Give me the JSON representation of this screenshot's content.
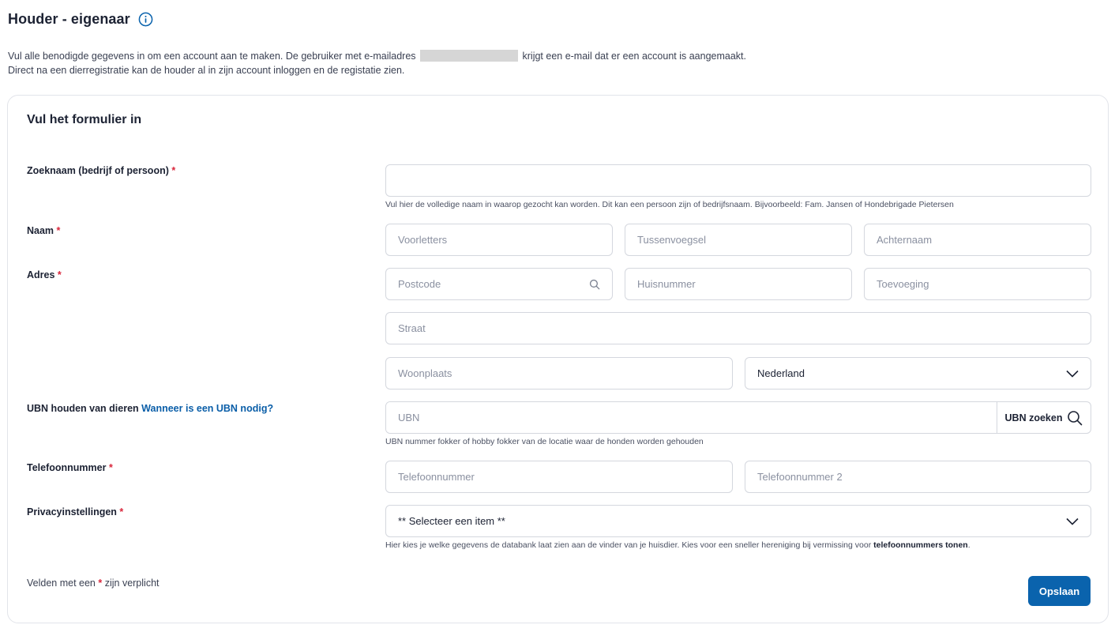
{
  "header": {
    "title": "Houder - eigenaar"
  },
  "intro": {
    "line1_before": "Vul alle benodigde gegevens in om een account aan te maken. De gebruiker met e-mailadres",
    "line1_after": "krijgt een e-mail dat er een account is aangemaakt.",
    "line2": "Direct na een dierregistratie kan de houder al in zijn account inloggen en de registatie zien."
  },
  "form": {
    "title": "Vul het formulier in",
    "required_mark": "*",
    "zoeknaam": {
      "label": "Zoeknaam (bedrijf of persoon)",
      "value": "",
      "help": "Vul hier de volledige naam in waarop gezocht kan worden. Dit kan een persoon zijn of bedrijfsnaam. Bijvoorbeeld: Fam. Jansen of Hondebrigade Pietersen"
    },
    "naam": {
      "label": "Naam",
      "voorletters_placeholder": "Voorletters",
      "tussenvoegsel_placeholder": "Tussenvoegsel",
      "achternaam_placeholder": "Achternaam"
    },
    "adres": {
      "label": "Adres",
      "postcode_placeholder": "Postcode",
      "huisnummer_placeholder": "Huisnummer",
      "toevoeging_placeholder": "Toevoeging",
      "straat_placeholder": "Straat",
      "woonplaats_placeholder": "Woonplaats",
      "land_selected": "Nederland"
    },
    "ubn": {
      "label": "UBN houden van dieren",
      "link": "Wanneer is een UBN nodig?",
      "placeholder": "UBN",
      "button": "UBN zoeken",
      "help": "UBN nummer fokker of hobby fokker van de locatie waar de honden worden gehouden"
    },
    "telefoon": {
      "label": "Telefoonnummer",
      "placeholder1": "Telefoonnummer",
      "placeholder2": "Telefoonnummer 2"
    },
    "privacy": {
      "label": "Privacyinstellingen",
      "selected": "** Selecteer een item **",
      "help_before": "Hier kies je welke gegevens de databank laat zien aan de vinder van je huisdier. Kies voor een sneller hereniging bij vermissing voor",
      "help_bold": "telefoonnummers tonen",
      "help_after": "."
    },
    "required_note_before": "Velden met een",
    "required_note_after": "zijn verplicht",
    "save_label": "Opslaan"
  },
  "colors": {
    "accent": "#0a63ad",
    "link": "#0a5ea8",
    "required": "#d9263b"
  }
}
